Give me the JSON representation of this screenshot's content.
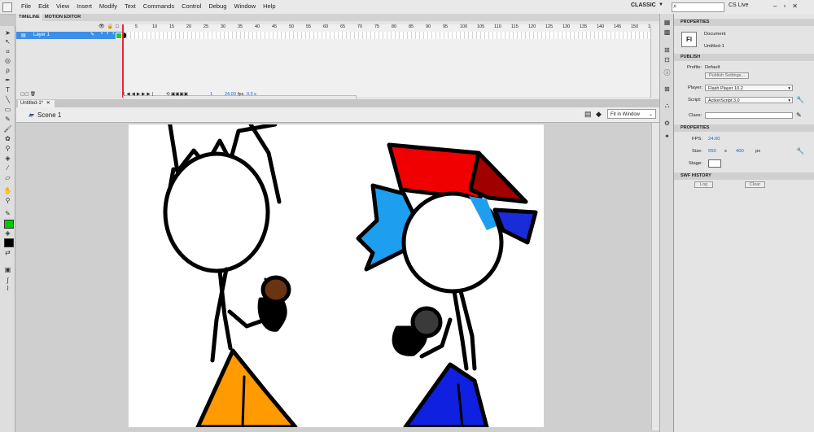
{
  "menubar": {
    "items": [
      "File",
      "Edit",
      "View",
      "Insert",
      "Modify",
      "Text",
      "Commands",
      "Control",
      "Debug",
      "Window",
      "Help"
    ],
    "workspace": "CLASSIC",
    "cs_live": "CS Live"
  },
  "timeline": {
    "tabs": [
      "TIMELINE",
      "MOTION EDITOR"
    ],
    "layer_name": "Layer 1",
    "frame_numbers": [
      "5",
      "10",
      "15",
      "20",
      "25",
      "30",
      "35",
      "40",
      "45",
      "50",
      "55",
      "60",
      "65",
      "70",
      "75",
      "80",
      "85",
      "90",
      "95",
      "100",
      "105",
      "110",
      "115",
      "120",
      "125",
      "130",
      "135",
      "140",
      "145",
      "150",
      "15"
    ],
    "current_frame": "1",
    "fps_value": "24.00",
    "fps_unit": "fps",
    "time": "0.0 s"
  },
  "document": {
    "tab_label": "Untitled-1*",
    "scene": "Scene 1",
    "zoom": "Fit in Window"
  },
  "properties": {
    "panel_title": "PROPERTIES",
    "doc_icon": "Fl",
    "doc_type": "Document",
    "doc_name": "Untitled-1",
    "publish_header": "PUBLISH",
    "profile_label": "Profile:",
    "profile_value": "Default",
    "publish_settings": "Publish Settings...",
    "player_label": "Player:",
    "player_value": "Flash Player 10.2",
    "script_label": "Script:",
    "script_value": "ActionScript 3.0",
    "class_label": "Class:",
    "properties_header": "PROPERTIES",
    "fps_label": "FPS:",
    "fps_value": "24.00",
    "size_label": "Size:",
    "width": "550",
    "x": "x",
    "height": "400",
    "unit": "px",
    "stage_label": "Stage:",
    "swf_header": "SWF HISTORY",
    "log_btn": "Log",
    "clear_btn": "Clear"
  },
  "colors": {
    "stroke_swatch": "#000000",
    "fill_swatch": "#00c800",
    "selected_layer": "#3d8ee6",
    "playhead": "#e23333"
  }
}
